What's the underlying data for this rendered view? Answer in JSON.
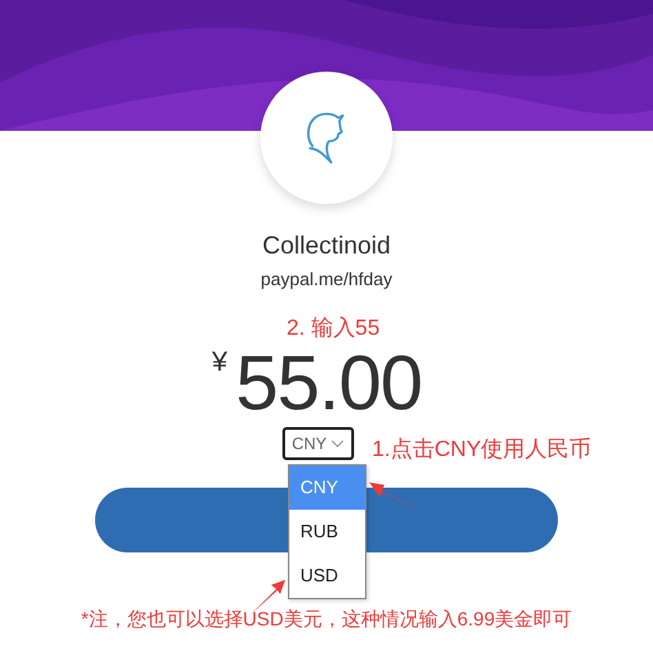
{
  "merchant": {
    "name": "Collectinoid",
    "link": "paypal.me/hfday"
  },
  "amount": {
    "currency_symbol": "¥",
    "value": "55.00"
  },
  "currency_select": {
    "value": "CNY",
    "expanded": true,
    "options": [
      {
        "label": "CNY",
        "selected": true
      },
      {
        "label": "RUB",
        "selected": false
      },
      {
        "label": "USD",
        "selected": false
      }
    ]
  },
  "annotations": [
    {
      "kind": "amount_hint",
      "text": "2. 输入55"
    },
    {
      "kind": "select_hint",
      "text": "1.点击CNY使用人民币"
    },
    {
      "kind": "note",
      "text": "*注，您也可以选择USD美元，这种情况输入6.99美金即可"
    }
  ]
}
